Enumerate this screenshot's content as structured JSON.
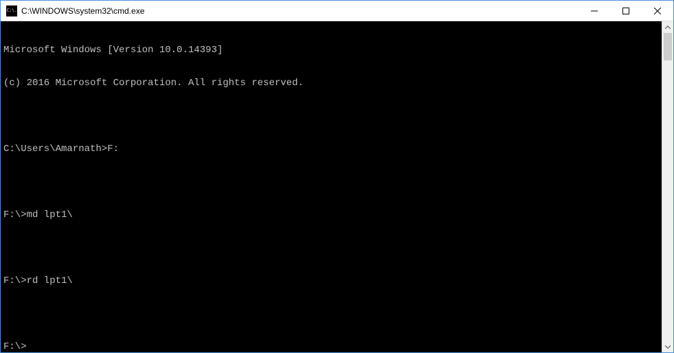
{
  "window": {
    "title": "C:\\WINDOWS\\system32\\cmd.exe",
    "icon_text": "C:\\."
  },
  "terminal": {
    "lines": [
      "Microsoft Windows [Version 10.0.14393]",
      "(c) 2016 Microsoft Corporation. All rights reserved.",
      "",
      "C:\\Users\\Amarnath>F:",
      "",
      "F:\\>md lpt1\\",
      "",
      "F:\\>rd lpt1\\",
      "",
      "F:\\>"
    ]
  }
}
